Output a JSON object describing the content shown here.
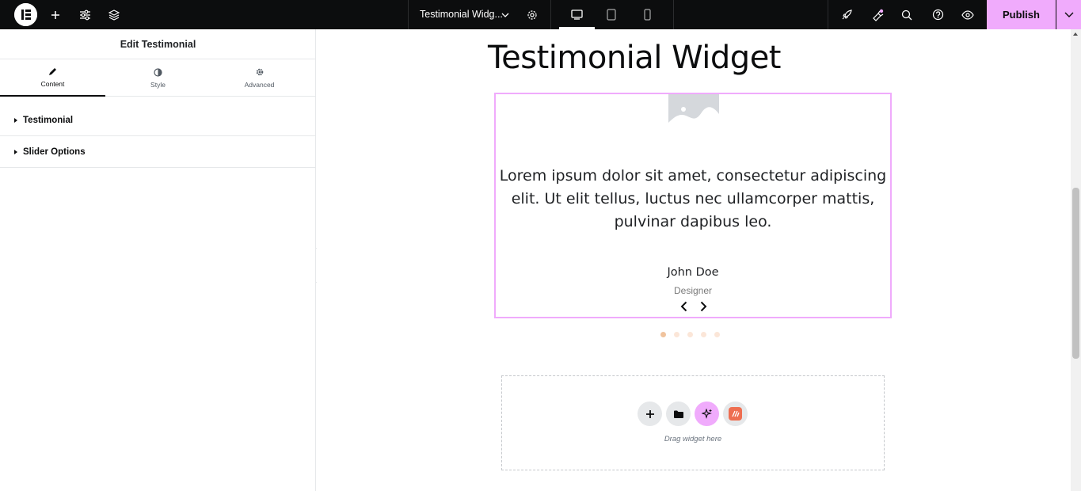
{
  "topbar": {
    "document_title": "Testimonial Widg...",
    "publish_label": "Publish",
    "logo": "elementor-logo-icon",
    "icons": [
      "plus-icon",
      "sliders-icon",
      "layers-icon",
      "chevron-down-icon",
      "gear-icon",
      "desktop-icon",
      "tablet-icon",
      "mobile-icon",
      "rocket-icon",
      "notifications-icon",
      "search-icon",
      "help-icon",
      "eye-icon"
    ],
    "accent_color": "#f0abfc"
  },
  "panel": {
    "title": "Edit Testimonial",
    "tabs": [
      {
        "label": "Content",
        "icon": "pencil-icon",
        "active": true
      },
      {
        "label": "Style",
        "icon": "contrast-icon",
        "active": false
      },
      {
        "label": "Advanced",
        "icon": "gear-icon",
        "active": false
      }
    ],
    "sections": [
      {
        "label": "Testimonial"
      },
      {
        "label": "Slider Options"
      }
    ]
  },
  "canvas": {
    "heading": "Testimonial Widget",
    "testimonial": {
      "quote": "Lorem ipsum dolor sit amet, consectetur adipiscing elit. Ut elit tellus, luctus nec ullamcorper mattis, pulvinar dapibus leo.",
      "name": "John Doe",
      "role": "Designer"
    },
    "slider": {
      "dot_count": 5,
      "active_dot": 1
    },
    "dropzone": {
      "text": "Drag widget here",
      "buttons": [
        "plus-icon",
        "folder-icon",
        "ai-sparkle-icon",
        "kit-icon"
      ]
    }
  }
}
